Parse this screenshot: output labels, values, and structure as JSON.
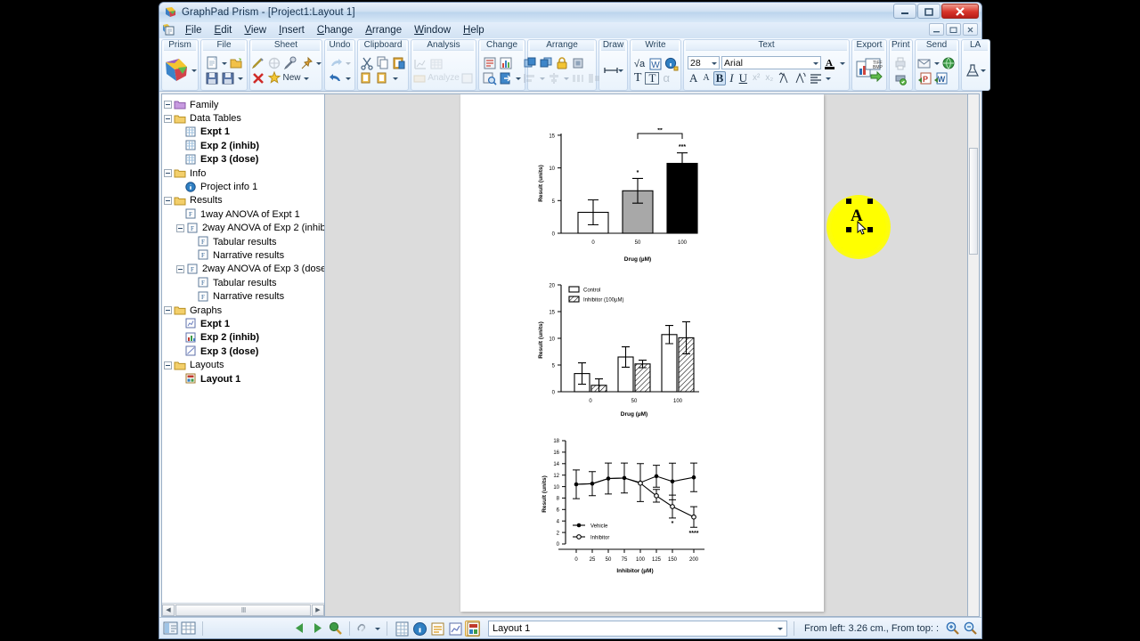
{
  "window": {
    "title": "GraphPad Prism - [Project1:Layout 1]",
    "app_name": "GraphPad Prism",
    "document": "Project1:Layout 1",
    "minimize_label": "—",
    "maximize_label": "❐",
    "close_label": "✕",
    "mdi_minimize_label": "—",
    "mdi_restore_label": "❐",
    "mdi_close_label": "✕"
  },
  "menu": {
    "items": [
      {
        "label": "File",
        "accel": "F"
      },
      {
        "label": "Edit",
        "accel": "E"
      },
      {
        "label": "View",
        "accel": "V"
      },
      {
        "label": "Insert",
        "accel": "I"
      },
      {
        "label": "Change",
        "accel": "C"
      },
      {
        "label": "Arrange",
        "accel": "A"
      },
      {
        "label": "Window",
        "accel": "W"
      },
      {
        "label": "Help",
        "accel": "H"
      }
    ]
  },
  "ribbon": {
    "groups": [
      {
        "title": "Prism"
      },
      {
        "title": "File"
      },
      {
        "title": "Sheet",
        "new_label": "New"
      },
      {
        "title": "Undo"
      },
      {
        "title": "Clipboard"
      },
      {
        "title": "Analysis",
        "analyze_label": "Analyze"
      },
      {
        "title": "Change"
      },
      {
        "title": "Arrange"
      },
      {
        "title": "Draw"
      },
      {
        "title": "Write",
        "sqrt_label": "√a",
        "text_label": "T",
        "textbox_label": "T",
        "alpha_label": "α"
      },
      {
        "title": "Text"
      },
      {
        "title": "Export"
      },
      {
        "title": "Print"
      },
      {
        "title": "Send"
      },
      {
        "title": "LA"
      }
    ],
    "text_group": {
      "font_size": "28",
      "font_name": "Arial",
      "bold_label": "B",
      "italic_label": "I",
      "underline_label": "U",
      "superscript_label": "x²",
      "subscript_label": "x₂",
      "grow_font_label": "A",
      "shrink_font_label": "A"
    }
  },
  "navigator": {
    "nodes": [
      {
        "label": "Family",
        "indent": 0,
        "expander": "minus",
        "icon": "folder-purple-icon",
        "bold": false
      },
      {
        "label": "Data Tables",
        "indent": 0,
        "expander": "minus",
        "icon": "folder-yellow-icon",
        "bold": false
      },
      {
        "label": "Expt 1",
        "indent": 1,
        "expander": "none",
        "icon": "table-icon",
        "bold": true
      },
      {
        "label": "Exp 2 (inhib)",
        "indent": 1,
        "expander": "none",
        "icon": "table-icon",
        "bold": true
      },
      {
        "label": "Exp 3 (dose)",
        "indent": 1,
        "expander": "none",
        "icon": "table-icon",
        "bold": true
      },
      {
        "label": "Info",
        "indent": 0,
        "expander": "minus",
        "icon": "folder-yellow-icon",
        "bold": false
      },
      {
        "label": "Project info 1",
        "indent": 1,
        "expander": "none",
        "icon": "info-icon",
        "bold": false
      },
      {
        "label": "Results",
        "indent": 0,
        "expander": "minus",
        "icon": "folder-yellow-icon",
        "bold": false
      },
      {
        "label": "1way ANOVA of Expt 1",
        "indent": 1,
        "expander": "none",
        "icon": "results-icon",
        "bold": false
      },
      {
        "label": "2way ANOVA of Exp 2 (inhib)",
        "indent": 1,
        "expander": "minus",
        "icon": "results-icon",
        "bold": false
      },
      {
        "label": "Tabular results",
        "indent": 2,
        "expander": "none",
        "icon": "results-icon",
        "bold": false
      },
      {
        "label": "Narrative results",
        "indent": 2,
        "expander": "none",
        "icon": "results-icon",
        "bold": false
      },
      {
        "label": "2way ANOVA of Exp 3 (dose)",
        "indent": 1,
        "expander": "minus",
        "icon": "results-icon",
        "bold": false
      },
      {
        "label": "Tabular results",
        "indent": 2,
        "expander": "none",
        "icon": "results-icon",
        "bold": false
      },
      {
        "label": "Narrative results",
        "indent": 2,
        "expander": "none",
        "icon": "results-icon",
        "bold": false
      },
      {
        "label": "Graphs",
        "indent": 0,
        "expander": "minus",
        "icon": "folder-yellow-icon",
        "bold": false
      },
      {
        "label": "Expt 1",
        "indent": 1,
        "expander": "none",
        "icon": "graph-icon",
        "bold": true
      },
      {
        "label": "Exp 2 (inhib)",
        "indent": 1,
        "expander": "none",
        "icon": "graph-bar-icon",
        "bold": true
      },
      {
        "label": "Exp 3 (dose)",
        "indent": 1,
        "expander": "none",
        "icon": "graph-line-icon",
        "bold": true
      },
      {
        "label": "Layouts",
        "indent": 0,
        "expander": "minus",
        "icon": "folder-yellow-icon",
        "bold": false
      },
      {
        "label": "Layout 1",
        "indent": 1,
        "expander": "none",
        "icon": "layout-icon",
        "bold": true
      }
    ],
    "scroll_left_label": "◀",
    "scroll_right_label": "▶",
    "scroll_grip_label": "‖‖"
  },
  "canvas": {
    "selected_object": {
      "text": "A",
      "highlight_color": "#ffff00"
    }
  },
  "status": {
    "prev_label": "◀",
    "next_label": "▶",
    "sheet_name": "Layout 1",
    "coordinates": "From left: 3.26 cm., From top: :",
    "zoom_in_label": "+",
    "zoom_out_label": "−"
  },
  "chart_data": [
    {
      "type": "bar",
      "id": "expt1-bar",
      "title": "",
      "xlabel": "Drug (µM)",
      "ylabel": "Result (units)",
      "categories": [
        "0",
        "50",
        "100"
      ],
      "values": [
        3.2,
        6.5,
        10.7
      ],
      "errors": [
        1.9,
        1.9,
        1.6
      ],
      "bar_colors": [
        "#ffffff",
        "#a8a8a8",
        "#000000"
      ],
      "ylim": [
        0,
        15
      ],
      "yticks": [
        0,
        5,
        10,
        15
      ],
      "grid": false,
      "annotations": [
        {
          "text": "*",
          "category": "50"
        },
        {
          "text": "***",
          "category": "100"
        },
        {
          "text": "**",
          "bracket_from": "50",
          "bracket_to": "100"
        }
      ]
    },
    {
      "type": "bar",
      "id": "exp2-grouped-bar",
      "title": "",
      "xlabel": "Drug (µM)",
      "ylabel": "Result (units)",
      "categories": [
        "0",
        "50",
        "100"
      ],
      "series": [
        {
          "name": "Control",
          "values": [
            3.4,
            6.5,
            10.7
          ],
          "errors": [
            2.0,
            1.9,
            1.7
          ],
          "fill": "open"
        },
        {
          "name": "Inhibitor (100µM)",
          "values": [
            1.2,
            5.2,
            10.1
          ],
          "errors": [
            1.2,
            0.7,
            3.0
          ],
          "fill": "hatched"
        }
      ],
      "ylim": [
        0,
        20
      ],
      "yticks": [
        0,
        5,
        10,
        15,
        20
      ],
      "legend_position": "top-left",
      "grid": false
    },
    {
      "type": "line",
      "id": "exp3-dose-line",
      "title": "",
      "xlabel": "Inhibitor (µM)",
      "ylabel": "Result (units)",
      "x": [
        0,
        25,
        50,
        75,
        100,
        125,
        150,
        200
      ],
      "series": [
        {
          "name": "Vehicle",
          "marker": "filled-circle",
          "values": [
            10.4,
            10.5,
            11.4,
            11.5,
            10.7,
            11.8,
            10.9,
            11.6
          ],
          "errors": [
            2.5,
            2.1,
            2.7,
            2.6,
            3.3,
            1.9,
            3.2,
            2.5
          ]
        },
        {
          "name": "Inhibitor",
          "marker": "open-circle",
          "values": [
            10.4,
            10.5,
            11.4,
            11.5,
            10.6,
            8.4,
            6.5,
            4.7
          ],
          "errors": [
            2.5,
            2.1,
            2.7,
            2.6,
            3.3,
            1.1,
            2.0,
            1.8
          ]
        }
      ],
      "ylim": [
        0,
        18
      ],
      "yticks": [
        0,
        2,
        4,
        6,
        8,
        10,
        12,
        14,
        16,
        18
      ],
      "xticks": [
        0,
        25,
        50,
        75,
        100,
        125,
        150,
        200
      ],
      "legend_position": "bottom-left",
      "grid": false,
      "annotations": [
        {
          "text": "*",
          "x": 150
        },
        {
          "text": "****",
          "x": 200
        }
      ]
    }
  ]
}
